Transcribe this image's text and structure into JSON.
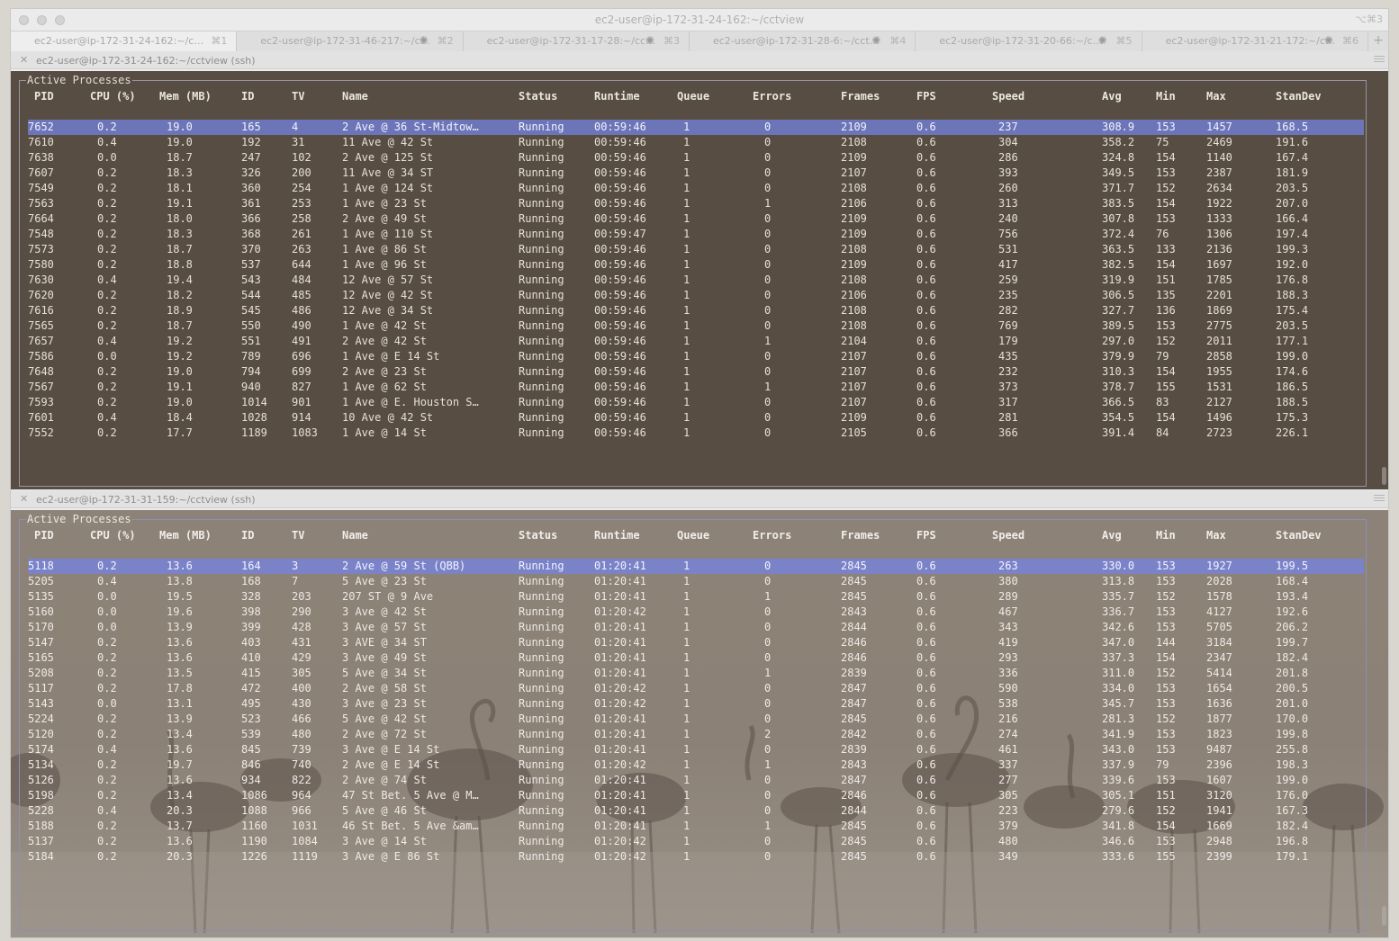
{
  "window": {
    "title": "ec2-user@ip-172-31-24-162:~/cctview",
    "shortcut": "⌥⌘3"
  },
  "tabs": [
    {
      "label": "ec2-user@ip-172-31-24-162:~/cctv…",
      "shortcut": "⌘1",
      "active": true,
      "busy": false
    },
    {
      "label": "ec2-user@ip-172-31-46-217:~/c…",
      "shortcut": "⌘2",
      "active": false,
      "busy": true
    },
    {
      "label": "ec2-user@ip-172-31-17-28:~/cct…",
      "shortcut": "⌘3",
      "active": false,
      "busy": true
    },
    {
      "label": "ec2-user@ip-172-31-28-6:~/cct…",
      "shortcut": "⌘4",
      "active": false,
      "busy": true
    },
    {
      "label": "ec2-user@ip-172-31-20-66:~/c…",
      "shortcut": "⌘5",
      "active": false,
      "busy": true
    },
    {
      "label": "ec2-user@ip-172-31-21-172:~/c…",
      "shortcut": "⌘6",
      "active": false,
      "busy": true
    }
  ],
  "columns": [
    "PID",
    "CPU (%)",
    "Mem (MB)",
    "ID",
    "TV",
    "Name",
    "Status",
    "Runtime",
    "Queue",
    "Errors",
    "Frames",
    "FPS",
    "Speed",
    "Avg",
    "Min",
    "Max",
    "StanDev"
  ],
  "panes": [
    {
      "title": "ec2-user@ip-172-31-24-162:~/cctview (ssh)",
      "box_title": "Active Processes",
      "rows": [
        [
          "7652",
          "0.2",
          "19.0",
          "165",
          "4",
          "2 Ave @ 36 St-Midtow…",
          "Running",
          "00:59:46",
          "1",
          "0",
          "2109",
          "0.6",
          "237",
          "308.9",
          "153",
          "1457",
          "168.5"
        ],
        [
          "7610",
          "0.4",
          "19.0",
          "192",
          "31",
          "11 Ave @ 42 St",
          "Running",
          "00:59:46",
          "1",
          "0",
          "2108",
          "0.6",
          "304",
          "358.2",
          "75",
          "2469",
          "191.6"
        ],
        [
          "7638",
          "0.0",
          "18.7",
          "247",
          "102",
          "2 Ave @ 125 St",
          "Running",
          "00:59:46",
          "1",
          "0",
          "2109",
          "0.6",
          "286",
          "324.8",
          "154",
          "1140",
          "167.4"
        ],
        [
          "7607",
          "0.2",
          "18.3",
          "326",
          "200",
          "11 Ave @ 34 ST",
          "Running",
          "00:59:46",
          "1",
          "0",
          "2107",
          "0.6",
          "393",
          "349.5",
          "153",
          "2387",
          "181.9"
        ],
        [
          "7549",
          "0.2",
          "18.1",
          "360",
          "254",
          "1 Ave @ 124 St",
          "Running",
          "00:59:46",
          "1",
          "0",
          "2108",
          "0.6",
          "260",
          "371.7",
          "152",
          "2634",
          "203.5"
        ],
        [
          "7563",
          "0.2",
          "19.1",
          "361",
          "253",
          "1 Ave @ 23 St",
          "Running",
          "00:59:46",
          "1",
          "1",
          "2106",
          "0.6",
          "313",
          "383.5",
          "154",
          "1922",
          "207.0"
        ],
        [
          "7664",
          "0.2",
          "18.0",
          "366",
          "258",
          "2 Ave @ 49 St",
          "Running",
          "00:59:46",
          "1",
          "0",
          "2109",
          "0.6",
          "240",
          "307.8",
          "153",
          "1333",
          "166.4"
        ],
        [
          "7548",
          "0.2",
          "18.3",
          "368",
          "261",
          "1 Ave @ 110 St",
          "Running",
          "00:59:47",
          "1",
          "0",
          "2109",
          "0.6",
          "756",
          "372.4",
          "76",
          "1306",
          "197.4"
        ],
        [
          "7573",
          "0.2",
          "18.7",
          "370",
          "263",
          "1 Ave @ 86 St",
          "Running",
          "00:59:46",
          "1",
          "0",
          "2108",
          "0.6",
          "531",
          "363.5",
          "133",
          "2136",
          "199.3"
        ],
        [
          "7580",
          "0.2",
          "18.8",
          "537",
          "644",
          "1 Ave @ 96 St",
          "Running",
          "00:59:46",
          "1",
          "0",
          "2109",
          "0.6",
          "417",
          "382.5",
          "154",
          "1697",
          "192.0"
        ],
        [
          "7630",
          "0.4",
          "19.4",
          "543",
          "484",
          "12 Ave @ 57 St",
          "Running",
          "00:59:46",
          "1",
          "0",
          "2108",
          "0.6",
          "259",
          "319.9",
          "151",
          "1785",
          "176.8"
        ],
        [
          "7620",
          "0.2",
          "18.2",
          "544",
          "485",
          "12 Ave @ 42 St",
          "Running",
          "00:59:46",
          "1",
          "0",
          "2106",
          "0.6",
          "235",
          "306.5",
          "135",
          "2201",
          "188.3"
        ],
        [
          "7616",
          "0.2",
          "18.9",
          "545",
          "486",
          "12 Ave @ 34 St",
          "Running",
          "00:59:46",
          "1",
          "0",
          "2108",
          "0.6",
          "282",
          "327.7",
          "136",
          "1869",
          "175.4"
        ],
        [
          "7565",
          "0.2",
          "18.7",
          "550",
          "490",
          "1 Ave @ 42 St",
          "Running",
          "00:59:46",
          "1",
          "0",
          "2108",
          "0.6",
          "769",
          "389.5",
          "153",
          "2775",
          "203.5"
        ],
        [
          "7657",
          "0.4",
          "19.2",
          "551",
          "491",
          "2 Ave @ 42 St",
          "Running",
          "00:59:46",
          "1",
          "1",
          "2104",
          "0.6",
          "179",
          "297.0",
          "152",
          "2011",
          "177.1"
        ],
        [
          "7586",
          "0.0",
          "19.2",
          "789",
          "696",
          "1 Ave @ E 14 St",
          "Running",
          "00:59:46",
          "1",
          "0",
          "2107",
          "0.6",
          "435",
          "379.9",
          "79",
          "2858",
          "199.0"
        ],
        [
          "7648",
          "0.2",
          "19.0",
          "794",
          "699",
          "2 Ave @ 23 St",
          "Running",
          "00:59:46",
          "1",
          "0",
          "2107",
          "0.6",
          "232",
          "310.3",
          "154",
          "1955",
          "174.6"
        ],
        [
          "7567",
          "0.2",
          "19.1",
          "940",
          "827",
          "1 Ave @ 62 St",
          "Running",
          "00:59:46",
          "1",
          "1",
          "2107",
          "0.6",
          "373",
          "378.7",
          "155",
          "1531",
          "186.5"
        ],
        [
          "7593",
          "0.2",
          "19.0",
          "1014",
          "901",
          "1 Ave @ E. Houston S…",
          "Running",
          "00:59:46",
          "1",
          "0",
          "2107",
          "0.6",
          "317",
          "366.5",
          "83",
          "2127",
          "188.5"
        ],
        [
          "7601",
          "0.4",
          "18.4",
          "1028",
          "914",
          "10 Ave @ 42 St",
          "Running",
          "00:59:46",
          "1",
          "0",
          "2109",
          "0.6",
          "281",
          "354.5",
          "154",
          "1496",
          "175.3"
        ],
        [
          "7552",
          "0.2",
          "17.7",
          "1189",
          "1083",
          "1 Ave @ 14 St",
          "Running",
          "00:59:46",
          "1",
          "0",
          "2105",
          "0.6",
          "366",
          "391.4",
          "84",
          "2723",
          "226.1"
        ]
      ]
    },
    {
      "title": "ec2-user@ip-172-31-31-159:~/cctview (ssh)",
      "box_title": "Active Processes",
      "rows": [
        [
          "5118",
          "0.2",
          "13.6",
          "164",
          "3",
          "2 Ave @ 59 St (QBB)",
          "Running",
          "01:20:41",
          "1",
          "0",
          "2845",
          "0.6",
          "263",
          "330.0",
          "153",
          "1927",
          "199.5"
        ],
        [
          "5205",
          "0.4",
          "13.8",
          "168",
          "7",
          "5 Ave @ 23 St",
          "Running",
          "01:20:41",
          "1",
          "0",
          "2845",
          "0.6",
          "380",
          "313.8",
          "153",
          "2028",
          "168.4"
        ],
        [
          "5135",
          "0.0",
          "19.5",
          "328",
          "203",
          "207 ST @ 9 Ave",
          "Running",
          "01:20:41",
          "1",
          "1",
          "2845",
          "0.6",
          "289",
          "335.7",
          "152",
          "1578",
          "193.4"
        ],
        [
          "5160",
          "0.0",
          "19.6",
          "398",
          "290",
          "3 Ave @ 42 St",
          "Running",
          "01:20:42",
          "1",
          "0",
          "2843",
          "0.6",
          "467",
          "336.7",
          "153",
          "4127",
          "192.6"
        ],
        [
          "5170",
          "0.0",
          "13.9",
          "399",
          "428",
          "3 Ave @ 57 St",
          "Running",
          "01:20:41",
          "1",
          "0",
          "2844",
          "0.6",
          "343",
          "342.6",
          "153",
          "5705",
          "206.2"
        ],
        [
          "5147",
          "0.2",
          "13.6",
          "403",
          "431",
          "3 AVE @ 34 ST",
          "Running",
          "01:20:41",
          "1",
          "0",
          "2846",
          "0.6",
          "419",
          "347.0",
          "144",
          "3184",
          "199.7"
        ],
        [
          "5165",
          "0.2",
          "13.6",
          "410",
          "429",
          "3 Ave @ 49 St",
          "Running",
          "01:20:41",
          "1",
          "0",
          "2846",
          "0.6",
          "293",
          "337.3",
          "154",
          "2347",
          "182.4"
        ],
        [
          "5208",
          "0.2",
          "13.5",
          "415",
          "305",
          "5 Ave @ 34 St",
          "Running",
          "01:20:41",
          "1",
          "1",
          "2839",
          "0.6",
          "336",
          "311.0",
          "152",
          "5414",
          "201.8"
        ],
        [
          "5117",
          "0.2",
          "17.8",
          "472",
          "400",
          "2 Ave @ 58 St",
          "Running",
          "01:20:42",
          "1",
          "0",
          "2847",
          "0.6",
          "590",
          "334.0",
          "153",
          "1654",
          "200.5"
        ],
        [
          "5143",
          "0.0",
          "13.1",
          "495",
          "430",
          "3 Ave @ 23 St",
          "Running",
          "01:20:42",
          "1",
          "0",
          "2847",
          "0.6",
          "538",
          "345.7",
          "153",
          "1636",
          "201.0"
        ],
        [
          "5224",
          "0.2",
          "13.9",
          "523",
          "466",
          "5 Ave @ 42 St",
          "Running",
          "01:20:41",
          "1",
          "0",
          "2845",
          "0.6",
          "216",
          "281.3",
          "152",
          "1877",
          "170.0"
        ],
        [
          "5120",
          "0.2",
          "13.4",
          "539",
          "480",
          "2 Ave @ 72 St",
          "Running",
          "01:20:41",
          "1",
          "2",
          "2842",
          "0.6",
          "274",
          "341.9",
          "153",
          "1823",
          "199.8"
        ],
        [
          "5174",
          "0.4",
          "13.6",
          "845",
          "739",
          "3 Ave @ E 14 St",
          "Running",
          "01:20:41",
          "1",
          "0",
          "2839",
          "0.6",
          "461",
          "343.0",
          "153",
          "9487",
          "255.8"
        ],
        [
          "5134",
          "0.2",
          "19.7",
          "846",
          "740",
          "2 Ave @ E 14 St",
          "Running",
          "01:20:42",
          "1",
          "1",
          "2843",
          "0.6",
          "337",
          "337.9",
          "79",
          "2396",
          "198.3"
        ],
        [
          "5126",
          "0.2",
          "13.6",
          "934",
          "822",
          "2 Ave @ 74 St",
          "Running",
          "01:20:41",
          "1",
          "0",
          "2847",
          "0.6",
          "277",
          "339.6",
          "153",
          "1607",
          "199.0"
        ],
        [
          "5198",
          "0.2",
          "13.4",
          "1086",
          "964",
          "47 St Bet. 5 Ave @ M…",
          "Running",
          "01:20:41",
          "1",
          "0",
          "2846",
          "0.6",
          "305",
          "305.1",
          "151",
          "3120",
          "176.0"
        ],
        [
          "5228",
          "0.4",
          "20.3",
          "1088",
          "966",
          "5 Ave @ 46 St",
          "Running",
          "01:20:41",
          "1",
          "0",
          "2844",
          "0.6",
          "223",
          "279.6",
          "152",
          "1941",
          "167.3"
        ],
        [
          "5188",
          "0.2",
          "13.7",
          "1160",
          "1031",
          "46 St Bet. 5 Ave &am…",
          "Running",
          "01:20:41",
          "1",
          "1",
          "2845",
          "0.6",
          "379",
          "341.8",
          "154",
          "1669",
          "182.4"
        ],
        [
          "5137",
          "0.2",
          "13.6",
          "1190",
          "1084",
          "3 Ave @ 14 St",
          "Running",
          "01:20:42",
          "1",
          "0",
          "2845",
          "0.6",
          "480",
          "346.6",
          "153",
          "2948",
          "196.8"
        ],
        [
          "5184",
          "0.2",
          "20.3",
          "1226",
          "1119",
          "3 Ave @ E 86 St",
          "Running",
          "01:20:42",
          "1",
          "0",
          "2845",
          "0.6",
          "349",
          "333.6",
          "155",
          "2399",
          "179.1"
        ]
      ]
    }
  ]
}
